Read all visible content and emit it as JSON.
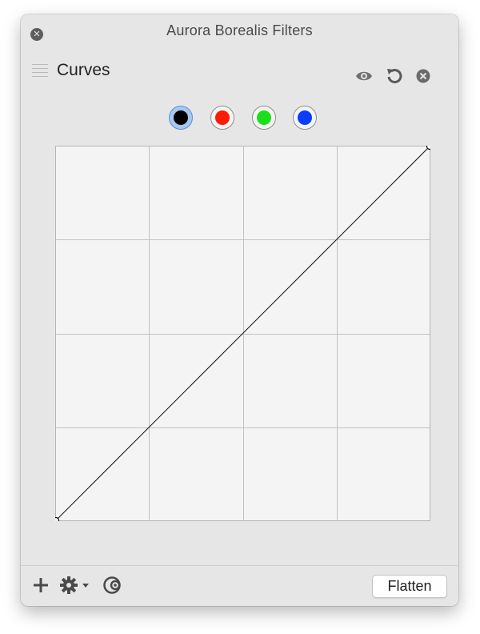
{
  "window": {
    "title": "Aurora Borealis Filters",
    "close_icon": "close-icon"
  },
  "panel": {
    "title": "Curves",
    "icons": [
      "eye-icon",
      "reset-icon",
      "close-icon"
    ]
  },
  "channels": [
    {
      "name": "master",
      "color": "#000000",
      "selected": true
    },
    {
      "name": "red",
      "color": "#ff1a00",
      "selected": false
    },
    {
      "name": "green",
      "color": "#18e01a",
      "selected": false
    },
    {
      "name": "blue",
      "color": "#0a3dff",
      "selected": false
    }
  ],
  "curve": {
    "grid_divisions": 4,
    "points": [
      [
        0,
        0
      ],
      [
        255,
        255
      ]
    ],
    "grid_color": "#c2c2c2",
    "background": "#f4f4f4",
    "line_color": "#111111"
  },
  "toolbar": {
    "add_icon": "plus-icon",
    "settings_icon": "gear-icon",
    "mask_icon": "mask-icon",
    "flatten_label": "Flatten"
  }
}
